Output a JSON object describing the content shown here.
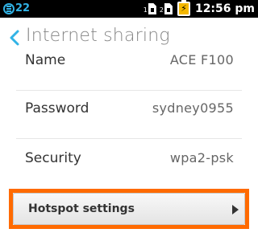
{
  "status_bar": {
    "notification_count": "22",
    "sim1_label": "1",
    "sim2_label": "2",
    "time": "12:56 pm",
    "battery_state": "charging",
    "notification_color": "#31b3e6",
    "battery_color": "#f5b800",
    "icons": [
      "notification-icon",
      "sim-card-icon",
      "battery-charging-icon"
    ]
  },
  "header": {
    "title": "Internet sharing",
    "back_icon": "chevron-left-icon",
    "accent": "#31b3e6"
  },
  "rows": [
    {
      "label": "Name",
      "value": "ACE F100"
    },
    {
      "label": "Password",
      "value": "sydney0955"
    },
    {
      "label": "Security",
      "value": "wpa2-psk"
    }
  ],
  "hotspot": {
    "label": "Hotspot settings",
    "arrow_icon": "arrow-right-icon",
    "highlight_color": "#ff6a00"
  }
}
